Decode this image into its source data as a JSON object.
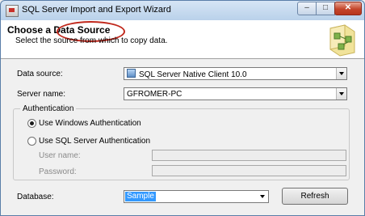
{
  "window": {
    "title": "SQL Server Import and Export Wizard",
    "buttons": {
      "minimize": "–",
      "maximize": "□",
      "close": "✕"
    }
  },
  "header": {
    "title_prefix": "Choose a",
    "title_highlight": "Data Source",
    "subtitle": "Select the source from which to copy data.",
    "highlight_color": "#c0281c"
  },
  "data_source": {
    "label": "Data source:",
    "value": "SQL Server Native Client 10.0",
    "icon": "data-source-icon"
  },
  "server_name": {
    "label": "Server name:",
    "value": "GFROMER-PC"
  },
  "authentication": {
    "legend": "Authentication",
    "windows_auth": {
      "label": "Use Windows Authentication",
      "checked": true
    },
    "sql_auth": {
      "label": "Use SQL Server Authentication",
      "checked": false
    },
    "username": {
      "label": "User name:",
      "value": ""
    },
    "password": {
      "label": "Password:",
      "value": ""
    }
  },
  "database": {
    "label": "Database:",
    "value": "Sample",
    "refresh_label": "Refresh"
  },
  "colors": {
    "title_bar": "#b9d1ea",
    "selection": "#3399ff",
    "close_button": "#c4452a"
  }
}
